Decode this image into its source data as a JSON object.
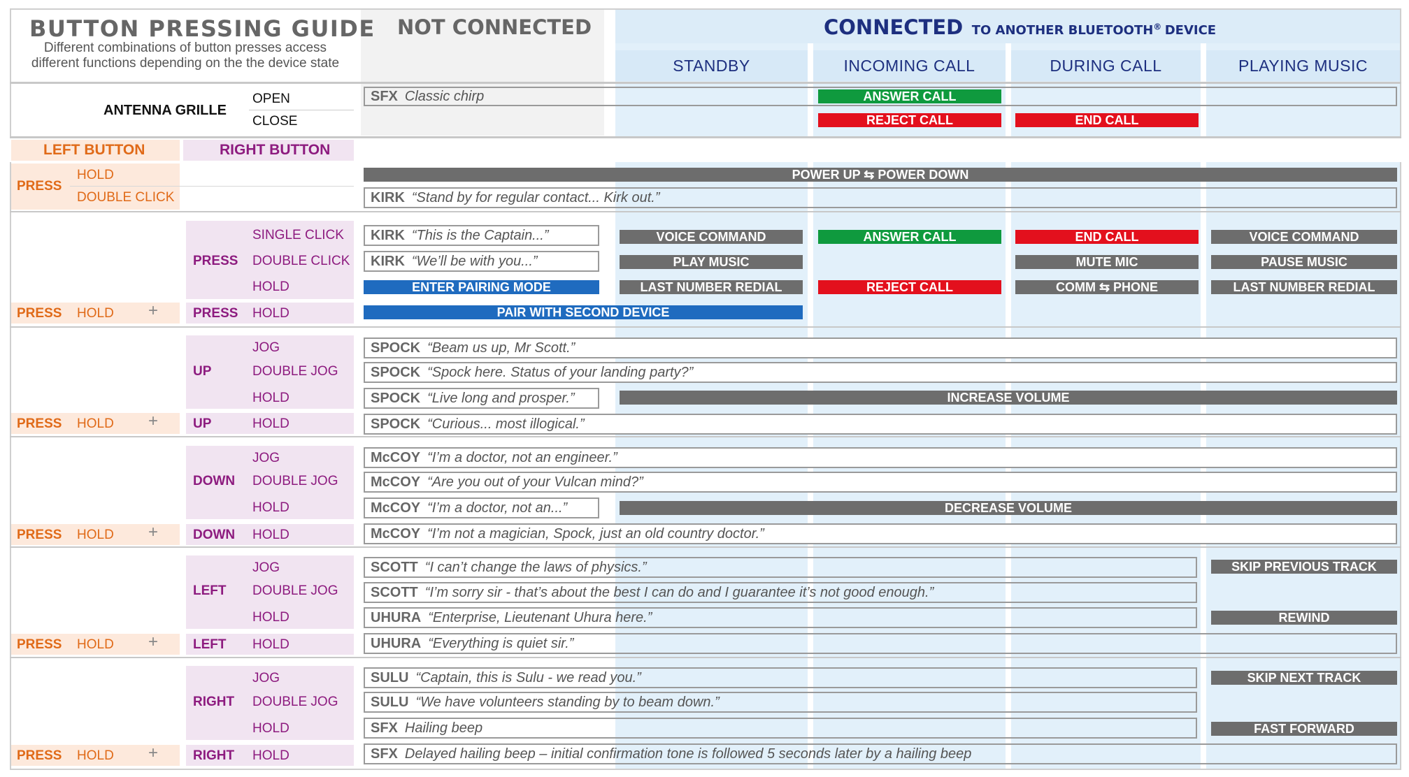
{
  "header": {
    "title": "BUTTON PRESSING GUIDE",
    "subtitle_line1": "Different combinations of button presses access",
    "subtitle_line2": "different functions depending on the the device state",
    "not_connected": "NOT CONNECTED",
    "connected": "CONNECTED",
    "connected_sub": "TO ANOTHER BLUETOOTH",
    "registered": "®",
    "connected_sub2": "DEVICE",
    "columns": [
      "STANDBY",
      "INCOMING CALL",
      "DURING CALL",
      "PLAYING MUSIC"
    ]
  },
  "antenna": {
    "label": "ANTENNA GRILLE",
    "open": "OPEN",
    "close": "CLOSE",
    "open_speaker": "SFX",
    "open_text": "Classic chirp",
    "answer_call": "ANSWER CALL",
    "reject_call": "REJECT CALL",
    "end_call": "END CALL"
  },
  "buttons": {
    "left": "LEFT BUTTON",
    "right": "RIGHT BUTTON",
    "press": "PRESS",
    "hold": "HOLD",
    "double_click": "DOUBLE CLICK",
    "single_click": "SINGLE CLICK",
    "plus": "+",
    "jog": "JOG",
    "double_jog": "DOUBLE JOG",
    "up": "UP",
    "down": "DOWN",
    "left_dir": "LEFT",
    "right_dir": "RIGHT"
  },
  "left_press": {
    "power": "POWER UP ⇆ POWER DOWN",
    "dbl_speaker": "KIRK",
    "dbl_text": "“Stand by for regular contact... Kirk out.”"
  },
  "right_press": {
    "single_speaker": "KIRK",
    "single_text": "“This is the Captain...”",
    "double_speaker": "KIRK",
    "double_text": "“We’ll be with you...”",
    "hold_action": "ENTER PAIRING MODE",
    "combo_action": "PAIR WITH SECOND DEVICE",
    "standby": [
      "VOICE COMMAND",
      "PLAY MUSIC",
      "LAST NUMBER REDIAL"
    ],
    "incoming": [
      "ANSWER CALL",
      "REJECT CALL"
    ],
    "during": [
      "END CALL",
      "MUTE MIC",
      "COMM ⇆ PHONE"
    ],
    "music": [
      "VOICE COMMAND",
      "PAUSE MUSIC",
      "LAST NUMBER REDIAL"
    ]
  },
  "up": {
    "jog_speaker": "SPOCK",
    "jog_text": "“Beam us up, Mr Scott.”",
    "dbl_speaker": "SPOCK",
    "dbl_text": "“Spock here. Status of your landing party?”",
    "hold_speaker": "SPOCK",
    "hold_text": "“Live long and prosper.”",
    "combo_speaker": "SPOCK",
    "combo_text": "“Curious... most illogical.”",
    "action": "INCREASE VOLUME"
  },
  "down": {
    "jog_speaker": "McCOY",
    "jog_text": "“I’m a doctor, not an engineer.”",
    "dbl_speaker": "McCOY",
    "dbl_text": "“Are you out of your Vulcan mind?”",
    "hold_speaker": "McCOY",
    "hold_text": "“I’m a doctor, not an...”",
    "combo_speaker": "McCOY",
    "combo_text": "“I’m not a magician, Spock, just an old country doctor.”",
    "action": "DECREASE VOLUME"
  },
  "left": {
    "jog_speaker": "SCOTT",
    "jog_text": "“I can’t change the laws of physics.”",
    "dbl_speaker": "SCOTT",
    "dbl_text": "“I’m sorry sir - that’s about the best I can do and I guarantee it’s not good enough.”",
    "hold_speaker": "UHURA",
    "hold_text": "“Enterprise, Lieutenant Uhura here.”",
    "combo_speaker": "UHURA",
    "combo_text": "“Everything is quiet sir.”",
    "jog_music": "SKIP PREVIOUS TRACK",
    "hold_music": "REWIND"
  },
  "right": {
    "jog_speaker": "SULU",
    "jog_text": "“Captain, this is Sulu - we read you.”",
    "dbl_speaker": "SULU",
    "dbl_text": "“We have volunteers standing by to beam down.”",
    "hold_speaker": "SFX",
    "hold_text": "Hailing beep",
    "combo_speaker": "SFX",
    "combo_text": "Delayed hailing beep – initial confirmation tone is followed 5 seconds later by a hailing beep",
    "jog_music": "SKIP NEXT TRACK",
    "hold_music": "FAST FORWARD"
  }
}
